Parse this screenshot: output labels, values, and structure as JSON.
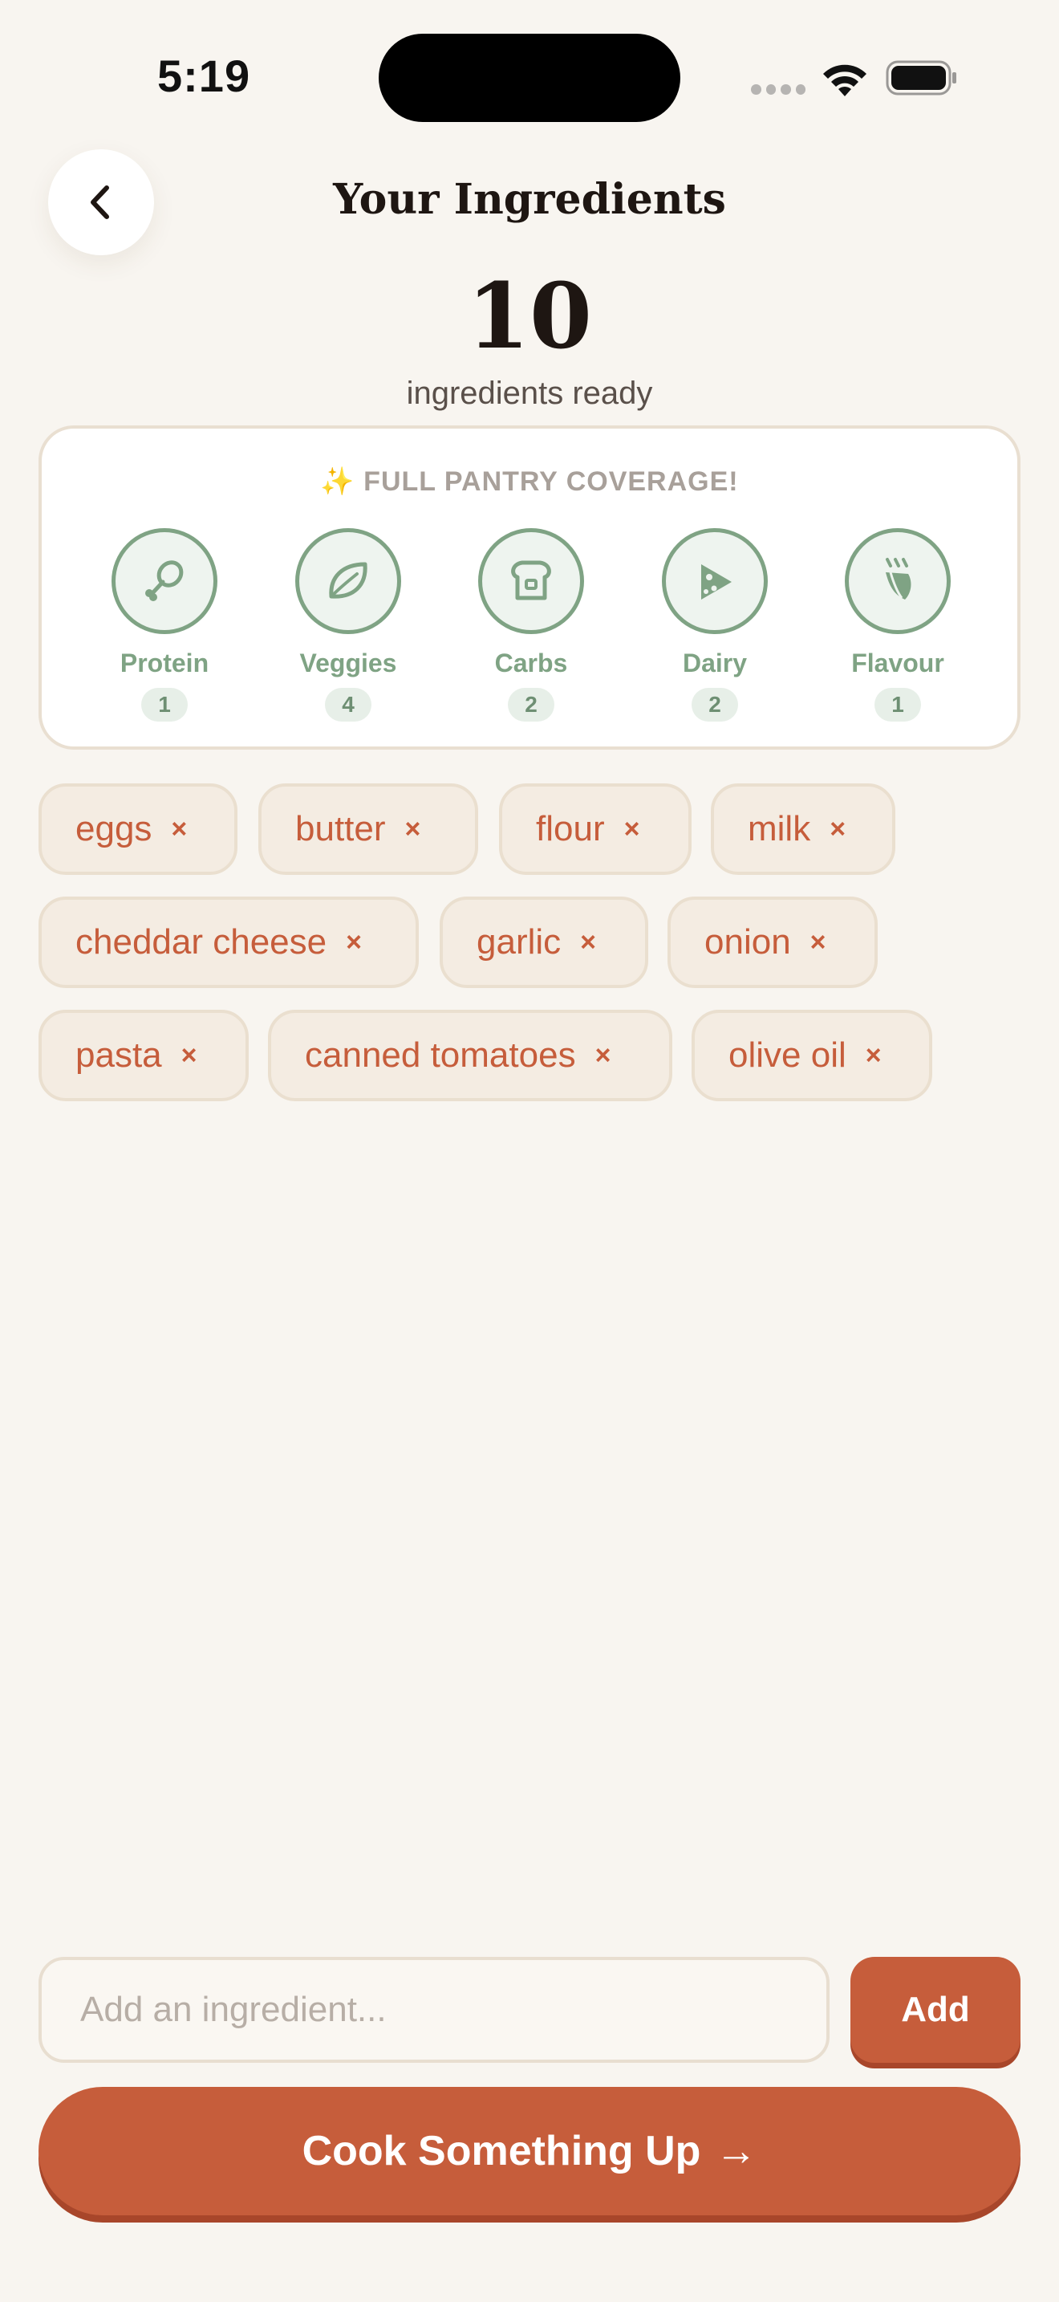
{
  "status_bar": {
    "time": "5:19"
  },
  "header": {
    "back_icon": "chevron-left-icon",
    "title": "Your Ingredients"
  },
  "summary": {
    "count": "10",
    "label": "ingredients ready"
  },
  "coverage": {
    "heading": "✨ FULL PANTRY COVERAGE!",
    "categories": [
      {
        "name": "Protein",
        "count": "1",
        "icon": "drumstick-icon"
      },
      {
        "name": "Veggies",
        "count": "4",
        "icon": "leaf-icon"
      },
      {
        "name": "Carbs",
        "count": "2",
        "icon": "bread-icon"
      },
      {
        "name": "Dairy",
        "count": "2",
        "icon": "cheese-icon"
      },
      {
        "name": "Flavour",
        "count": "1",
        "icon": "spice-icon"
      }
    ]
  },
  "ingredients": [
    {
      "label": "eggs",
      "remove": "×"
    },
    {
      "label": "butter",
      "remove": "×"
    },
    {
      "label": "flour",
      "remove": "×"
    },
    {
      "label": "milk",
      "remove": "×"
    },
    {
      "label": "cheddar cheese",
      "remove": "×"
    },
    {
      "label": "garlic",
      "remove": "×"
    },
    {
      "label": "onion",
      "remove": "×"
    },
    {
      "label": "pasta",
      "remove": "×"
    },
    {
      "label": "canned tomatoes",
      "remove": "×"
    },
    {
      "label": "olive oil",
      "remove": "×"
    }
  ],
  "input": {
    "placeholder": "Add an ingredient...",
    "value": ""
  },
  "actions": {
    "add_label": "Add",
    "cook_label": "Cook Something Up",
    "cook_arrow": "→"
  },
  "colors": {
    "background": "#F8F5F0",
    "accent": "#C65D3B",
    "accent_dark": "#A8462A",
    "sage": "#7FA384",
    "chip_bg": "#F4ECE2",
    "title": "#1E1612"
  }
}
